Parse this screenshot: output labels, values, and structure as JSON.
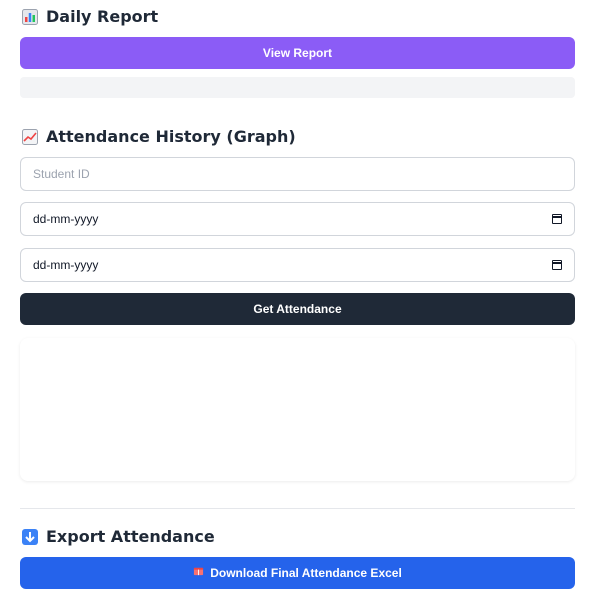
{
  "daily_report": {
    "title": "Daily Report",
    "icon": "bar-chart-icon",
    "view_button_label": "View Report"
  },
  "attendance_history": {
    "title": "Attendance History (Graph)",
    "icon": "line-chart-icon",
    "student_id_placeholder": "Student ID",
    "from_date_value": "dd-mm-yyyy",
    "to_date_value": "dd-mm-yyyy",
    "get_button_label": "Get Attendance"
  },
  "export": {
    "title": "Export Attendance",
    "icon": "down-arrow-icon",
    "download_button_label": "Download Final Attendance Excel",
    "download_icon": "book-icon"
  },
  "colors": {
    "purple": "#8b5cf6",
    "dark": "#1f2937",
    "blue": "#2563eb"
  }
}
